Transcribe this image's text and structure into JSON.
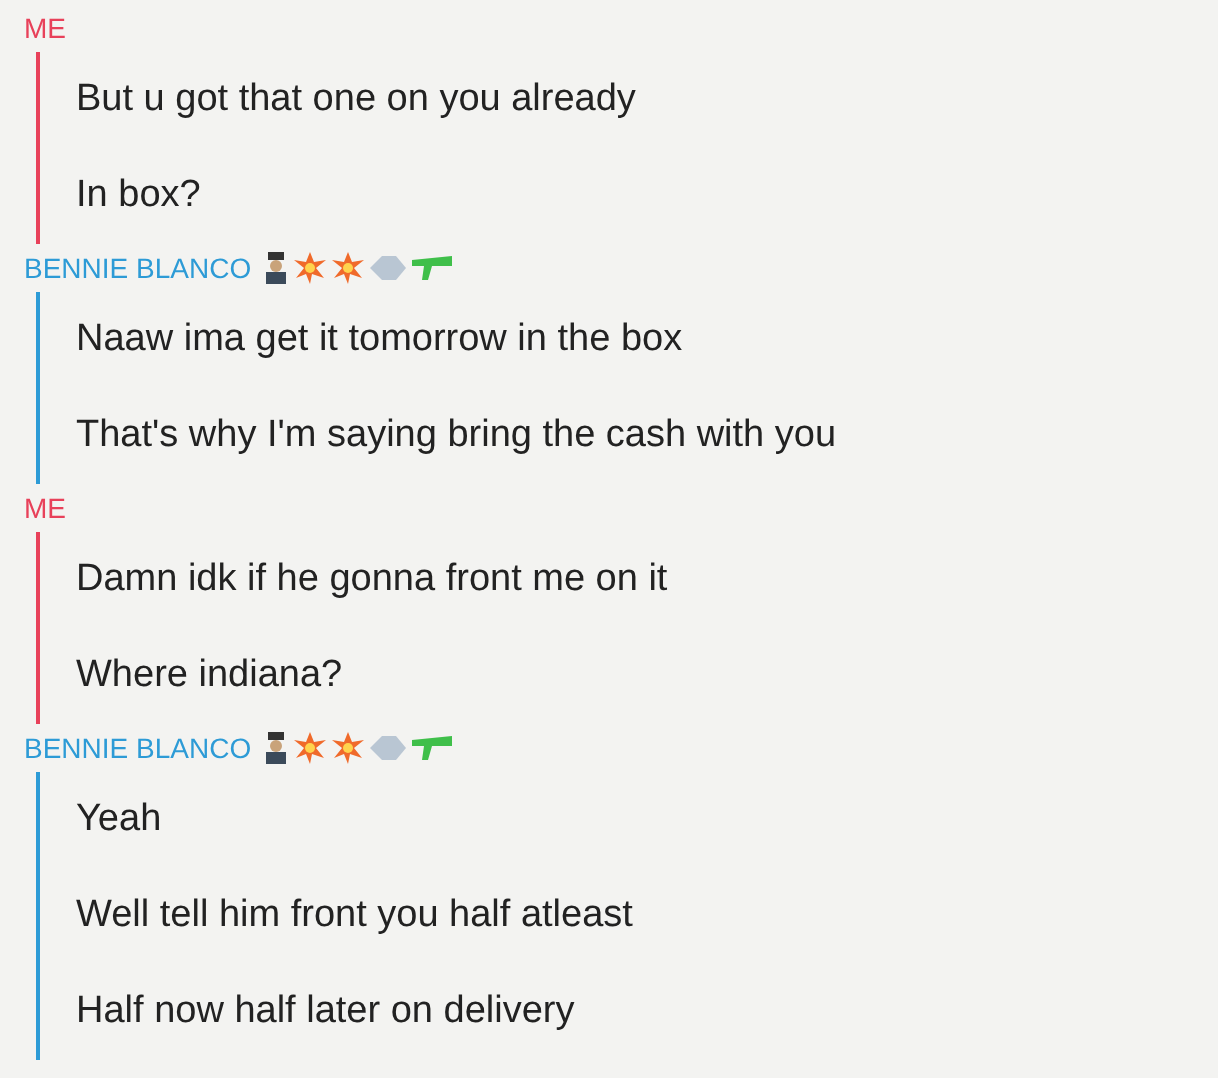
{
  "groups": [
    {
      "sender": {
        "name": "ME",
        "kind": "me",
        "badges": false
      },
      "messages": [
        "But u got that one on you already",
        "In box?"
      ]
    },
    {
      "sender": {
        "name": "BENNIE BLANCO",
        "kind": "friend",
        "badges": true
      },
      "messages": [
        "Naaw ima get it tomorrow in the box",
        "That's why I'm saying bring the cash with you"
      ]
    },
    {
      "sender": {
        "name": "ME",
        "kind": "me",
        "badges": false
      },
      "messages": [
        "Damn idk if he gonna front me on it",
        "Where indiana?"
      ]
    },
    {
      "sender": {
        "name": "BENNIE BLANCO",
        "kind": "friend",
        "badges": true
      },
      "messages": [
        "Yeah",
        "Well tell him front you half atleast",
        "Half now half later on delivery"
      ]
    }
  ]
}
